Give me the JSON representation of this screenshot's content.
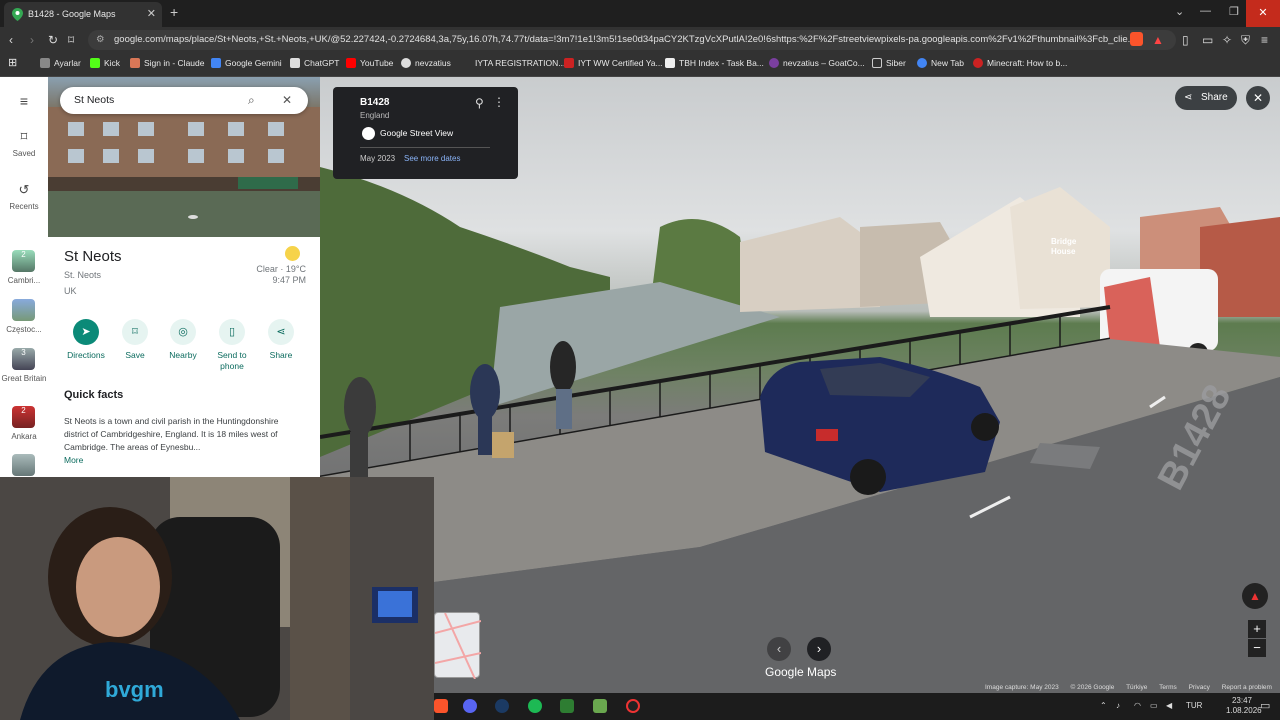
{
  "browser": {
    "tab_title": "B1428 - Google Maps",
    "url": "google.com/maps/place/St+Neots,+St.+Neots,+UK/@52.227424,-0.2724684,3a,75y,16.07h,74.77t/data=!3m7!1e1!3m5!1se0d34paCY2KTzgVcXPutlA!2e0!6shttps:%2F%2Fstreetviewpixels-pa.googleapis.com%2Fv1%2Fthumbnail%3Fcb_clie...",
    "bookmarks": [
      "Ayarlar",
      "Kick",
      "Sign in - Claude",
      "Google Gemini",
      "ChatGPT",
      "YouTube",
      "nevzatius",
      "IYTA REGISTRATION...",
      "IYT WW Certified Ya...",
      "TBH Index - Task Ba...",
      "nevzatius – GoatCo...",
      "Siber",
      "New Tab",
      "Minecraft: How to b..."
    ],
    "bookmark_colors": [
      "#888888",
      "#53fc18",
      "#d97757",
      "#4285f4",
      "#ffffff",
      "#ff0000",
      "#ffffff",
      "#333333",
      "#cc2222",
      "#ffffff",
      "#7b3fa0",
      "#f0c040",
      "#4285f4",
      "#cc2222"
    ]
  },
  "rail": {
    "saved": "Saved",
    "recents": "Recents",
    "recent_items": [
      {
        "label": "Cambri...",
        "badge": "2"
      },
      {
        "label": "Częstoc...",
        "badge": ""
      },
      {
        "label": "Great Britain",
        "badge": "3"
      },
      {
        "label": "Ankara",
        "badge": "2"
      },
      {
        "label": "",
        "badge": ""
      }
    ]
  },
  "panel": {
    "search_value": "St Neots",
    "title": "St Neots",
    "subtitle1": "St. Neots",
    "subtitle2": "UK",
    "weather": "Clear · 19°C",
    "time": "9:47 PM",
    "actions": [
      "Directions",
      "Save",
      "Nearby",
      "Send to phone",
      "Share"
    ],
    "quick_facts_title": "Quick facts",
    "quick_facts_text": "St Neots is a town and civil parish in the Huntingdonshire district of Cambridgeshire, England. It is 18 miles west of Cambridge. The areas of Eynesbu...",
    "more": "More"
  },
  "streetview": {
    "road": "B1428",
    "region": "England",
    "provider": "Google Street View",
    "date": "May 2023",
    "see_more": "See more dates",
    "share": "Share",
    "brand": "Google Maps",
    "bridge_sign": "Bridge House",
    "road_marking": "B1428",
    "footer": [
      "Image capture: May 2023",
      "© 2026 Google",
      "Türkiye",
      "Terms",
      "Privacy",
      "Report a problem"
    ]
  },
  "taskbar": {
    "lang": "TUR",
    "time": "23:47",
    "date": "1.08.2026"
  }
}
